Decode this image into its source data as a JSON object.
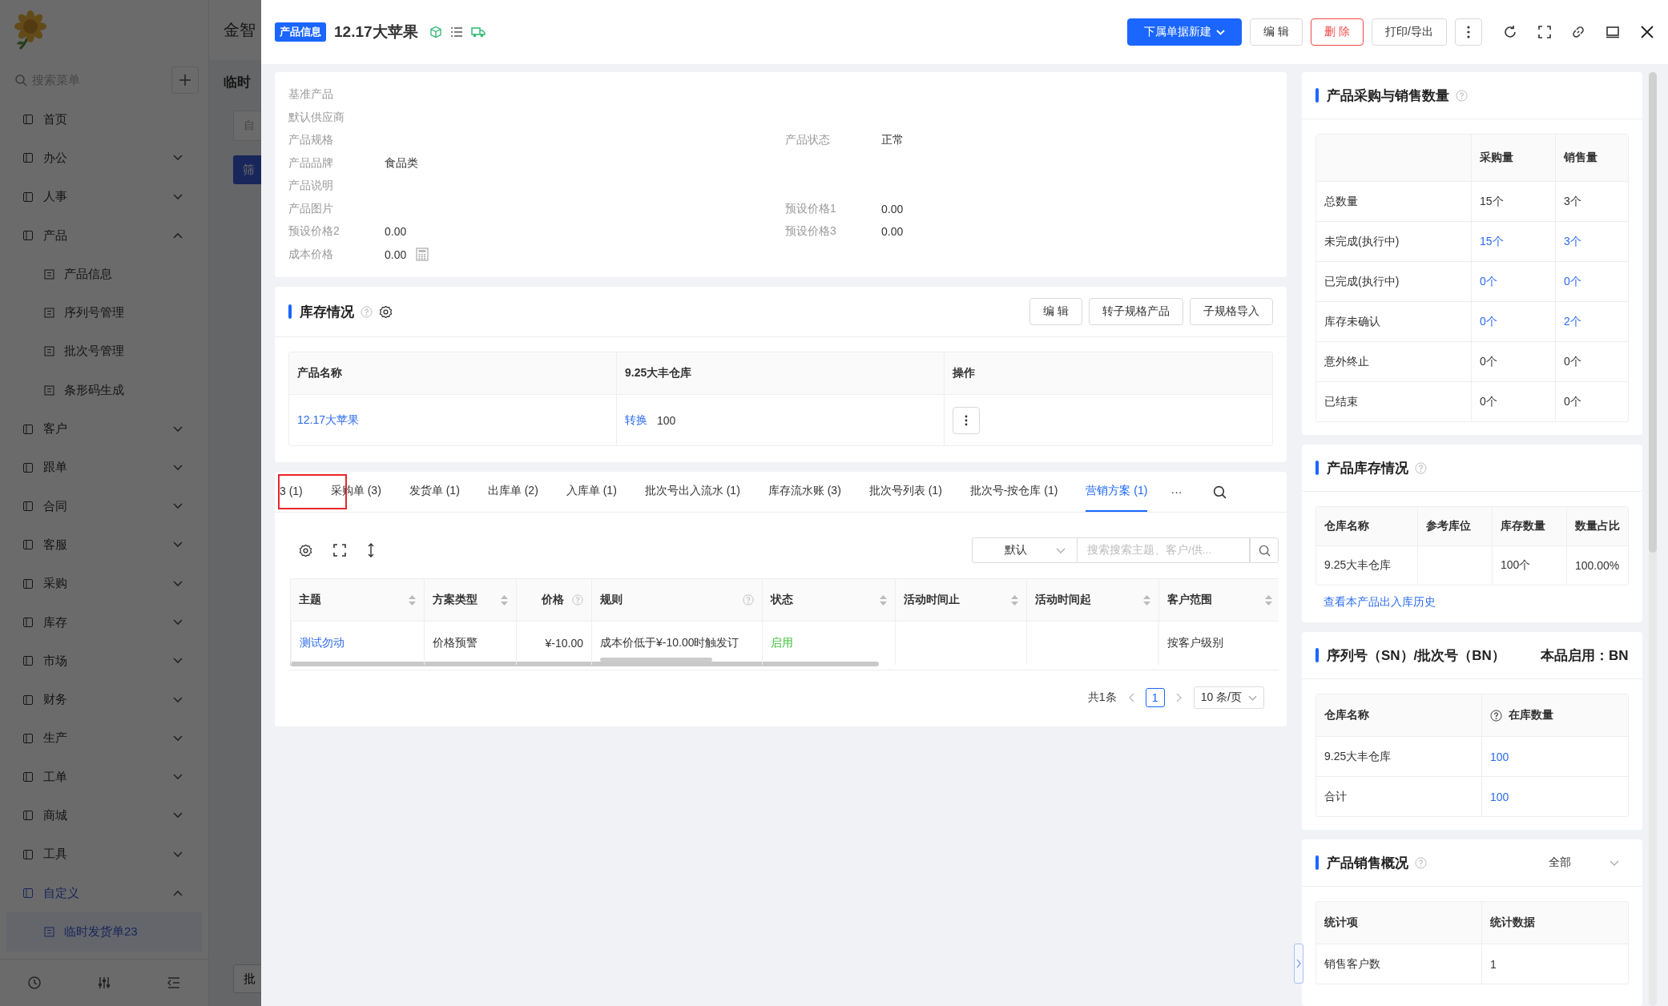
{
  "background_app": {
    "header_title": "金智",
    "page_title": "临时",
    "field_placeholder": "自",
    "filter_button": "筛",
    "bottom_button": "批",
    "sidebar": {
      "search_placeholder": "搜索菜单",
      "items": [
        {
          "label": "首页"
        },
        {
          "label": "办公",
          "expanded": false
        },
        {
          "label": "人事",
          "expanded": false
        },
        {
          "label": "产品",
          "expanded": true,
          "children": [
            {
              "label": "产品信息",
              "selected": false
            },
            {
              "label": "序列号管理",
              "selected": false
            },
            {
              "label": "批次号管理",
              "selected": false
            },
            {
              "label": "条形码生成",
              "selected": false
            }
          ]
        },
        {
          "label": "客户",
          "expanded": false
        },
        {
          "label": "跟单",
          "expanded": false
        },
        {
          "label": "合同",
          "expanded": false
        },
        {
          "label": "客服",
          "expanded": false
        },
        {
          "label": "采购",
          "expanded": false
        },
        {
          "label": "库存",
          "expanded": false
        },
        {
          "label": "市场",
          "expanded": false
        },
        {
          "label": "财务",
          "expanded": false
        },
        {
          "label": "生产",
          "expanded": false
        },
        {
          "label": "工单",
          "expanded": false
        },
        {
          "label": "商城",
          "expanded": false
        },
        {
          "label": "工具",
          "expanded": false
        },
        {
          "label": "自定义",
          "expanded": true,
          "children": [
            {
              "label": "临时发货单23",
              "selected": true
            }
          ]
        }
      ]
    }
  },
  "drawer": {
    "tag": "产品信息",
    "title": "12.17大苹果",
    "actions": [
      {
        "label": "下属单据新建",
        "kind": "primary"
      },
      {
        "label": "编 辑",
        "kind": "default"
      },
      {
        "label": "删 除",
        "kind": "danger"
      },
      {
        "label": "打印/导出",
        "kind": "default"
      }
    ],
    "info": {
      "rows": [
        [
          {
            "label": "基准产品"
          }
        ],
        [
          {
            "label": "默认供应商"
          }
        ],
        [
          {
            "label": "产品规格"
          },
          {
            "label": "产品状态",
            "value": "正常"
          }
        ],
        [
          {
            "label": "产品品牌",
            "value": "食品类"
          }
        ],
        [
          {
            "label": "产品说明"
          }
        ],
        [
          {
            "label": "产品图片"
          },
          {
            "label": "预设价格1",
            "value": "0.00"
          }
        ],
        [
          {
            "label": "预设价格2",
            "value": "0.00"
          },
          {
            "label": "预设价格3",
            "value": "0.00"
          }
        ],
        [
          {
            "label": "成本价格",
            "value": "0.00",
            "calculator": true
          }
        ]
      ]
    },
    "stock": {
      "title": "库存情况",
      "buttons": [
        "编 辑",
        "转子规格产品",
        "子规格导入"
      ],
      "columns": [
        "产品名称",
        "9.25大丰仓库",
        "操作"
      ],
      "rows": [
        {
          "product": "12.17大苹果",
          "convert": "转换",
          "quantity": "100"
        }
      ]
    },
    "records": {
      "tabs": [
        {
          "label": "3 (1)",
          "selected": false
        },
        {
          "label": "采购单 (3)",
          "selected": false
        },
        {
          "label": "发货单 (1)",
          "selected": false
        },
        {
          "label": "出库单 (2)",
          "selected": false
        },
        {
          "label": "入库单 (1)",
          "selected": false
        },
        {
          "label": "批次号出入流水 (1)",
          "selected": false
        },
        {
          "label": "库存流水账 (3)",
          "selected": false
        },
        {
          "label": "批次号列表 (1)",
          "selected": false
        },
        {
          "label": "批次号-按仓库 (1)",
          "selected": false
        },
        {
          "label": "营销方案 (1)",
          "selected": true
        }
      ],
      "more": "···",
      "filter_value": "默认",
      "search_placeholder": "搜索搜索主题、客户/供...",
      "columns": [
        {
          "label": "主题",
          "sortable": true,
          "help": false
        },
        {
          "label": "方案类型",
          "sortable": true,
          "help": false
        },
        {
          "label": "价格",
          "sortable": false,
          "help": true
        },
        {
          "label": "规则",
          "sortable": false,
          "help": true
        },
        {
          "label": "状态",
          "sortable": true,
          "help": false
        },
        {
          "label": "活动时间止",
          "sortable": true,
          "help": false
        },
        {
          "label": "活动时间起",
          "sortable": true,
          "help": false
        },
        {
          "label": "客户范围",
          "sortable": true,
          "help": false
        }
      ],
      "rows": [
        [
          {
            "text": "测试勿动",
            "kind": "link"
          },
          {
            "text": "价格预警",
            "kind": "text"
          },
          {
            "text": "¥-10.00",
            "kind": "text"
          },
          {
            "text": "成本价低于¥-10.00时触发订",
            "kind": "text"
          },
          {
            "text": "启用",
            "kind": "status"
          },
          {
            "text": "",
            "kind": "text"
          },
          {
            "text": "",
            "kind": "text"
          },
          {
            "text": "按客户级别",
            "kind": "text"
          }
        ]
      ],
      "total": "共1条",
      "pages": [
        {
          "label": "1",
          "selected": true
        }
      ],
      "page_size": "10 条/页"
    },
    "quantities": {
      "title": "产品采购与销售数量",
      "columns": [
        "",
        "采购量",
        "销售量"
      ],
      "rows": [
        {
          "label": "总数量",
          "purchase": "15个",
          "sales": "3个",
          "link": false
        },
        {
          "label": "未完成(执行中)",
          "purchase": "15个",
          "sales": "3个",
          "link": true
        },
        {
          "label": "已完成(执行中)",
          "purchase": "0个",
          "sales": "0个",
          "link": true
        },
        {
          "label": "库存未确认",
          "purchase": "0个",
          "sales": "2个",
          "link": true
        },
        {
          "label": "意外终止",
          "purchase": "0个",
          "sales": "0个",
          "link": false
        },
        {
          "label": "已结束",
          "purchase": "0个",
          "sales": "0个",
          "link": false
        }
      ]
    },
    "inventory": {
      "title": "产品库存情况",
      "columns": [
        "仓库名称",
        "参考库位",
        "库存数量",
        "数量占比"
      ],
      "rows": [
        [
          "9.25大丰仓库",
          "",
          "100个",
          "100.00%"
        ]
      ],
      "history_link": "查看本产品出入库历史"
    },
    "serials": {
      "title": "序列号（SN）/批次号（BN）",
      "enabled": "本品启用：BN",
      "columns": [
        "仓库名称",
        "在库数量"
      ],
      "rows": [
        [
          "9.25大丰仓库",
          "100"
        ],
        [
          "合计",
          "100"
        ]
      ]
    },
    "sales": {
      "title": "产品销售概况",
      "filter": "全部",
      "columns": [
        "统计项",
        "统计数据"
      ],
      "rows": [
        [
          "销售客户数",
          "1"
        ]
      ]
    }
  }
}
